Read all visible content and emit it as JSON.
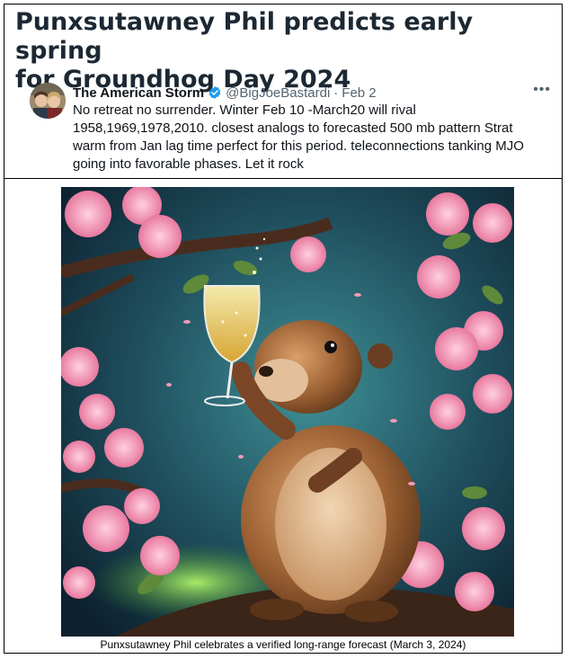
{
  "headline": {
    "line1": "Punxsutawney Phil predicts early spring",
    "line2": "for Groundhog Day 2024"
  },
  "tweet": {
    "author": "The American Storm",
    "verified_icon": "verified-badge-icon",
    "handle": "@BigJoeBastardi",
    "separator": "·",
    "date": "Feb 2",
    "more_icon": "more-options-icon",
    "more_label": "•••",
    "text": "No retreat no surrender. Winter Feb 10 -March20  will rival 1958,1969,1978,2010. closest analogs to forecasted 500 mb pattern  Strat warm from Jan lag time perfect for this period. teleconnections tanking MJO going into favorable phases. Let it rock",
    "colors": {
      "verified": "#1d9bf0",
      "muted": "#536471",
      "text": "#0f1419"
    }
  },
  "image": {
    "subject": "groundhog-toasting-champagne-among-cherry-blossoms"
  },
  "caption": "Punxsutawney Phil celebrates a verified long-range forecast (March 3, 2024)"
}
